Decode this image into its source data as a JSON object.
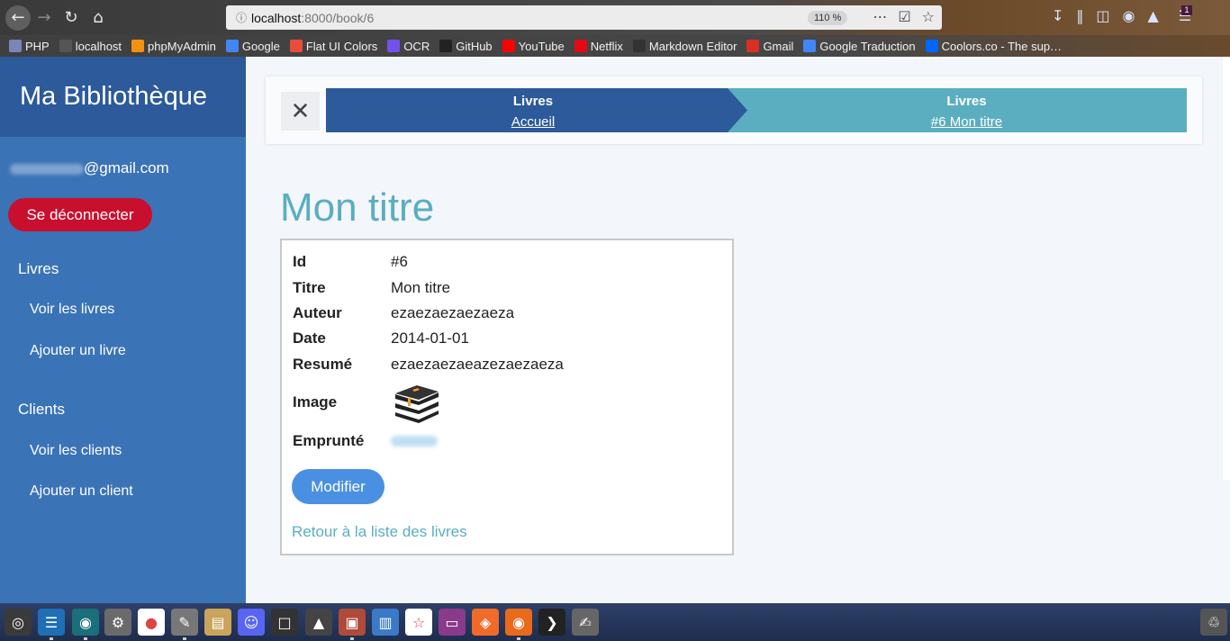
{
  "browser": {
    "url_host": "localhost",
    "url_rest": ":8000/book/6",
    "zoom": "110 %",
    "bookmarks": [
      {
        "label": "PHP",
        "icon": "php-icon",
        "color": "#7a86b8"
      },
      {
        "label": "localhost",
        "icon": "globe-icon",
        "color": "#555555"
      },
      {
        "label": "phpMyAdmin",
        "icon": "phpmyadmin-icon",
        "color": "#f29111"
      },
      {
        "label": "Google",
        "icon": "google-icon",
        "color": "#4285f4"
      },
      {
        "label": "Flat UI Colors",
        "icon": "flatui-icon",
        "color": "#e74c3c"
      },
      {
        "label": "OCR",
        "icon": "ocr-icon",
        "color": "#7451eb"
      },
      {
        "label": "GitHub",
        "icon": "github-icon",
        "color": "#222222"
      },
      {
        "label": "YouTube",
        "icon": "youtube-icon",
        "color": "#ff0000"
      },
      {
        "label": "Netflix",
        "icon": "netflix-icon",
        "color": "#e50914"
      },
      {
        "label": "Markdown Editor",
        "icon": "markdown-icon",
        "color": "#333333"
      },
      {
        "label": "Gmail",
        "icon": "gmail-icon",
        "color": "#d93025"
      },
      {
        "label": "Google Traduction",
        "icon": "translate-icon",
        "color": "#4285f4"
      },
      {
        "label": "Coolors.co - The sup…",
        "icon": "coolors-icon",
        "color": "#0066ff"
      }
    ],
    "notification_count": "1"
  },
  "sidebar": {
    "title": "Ma Bibliothèque",
    "email_visible": "@gmail.com",
    "logout_label": "Se déconnecter",
    "sections": [
      {
        "label": "Livres",
        "links": [
          "Voir les livres",
          "Ajouter un livre"
        ]
      },
      {
        "label": "Clients",
        "links": [
          "Voir les clients",
          "Ajouter un client"
        ]
      }
    ]
  },
  "breadcrumb": {
    "items": [
      {
        "title": "Livres",
        "link": "Accueil",
        "color": "#2c5a9a"
      },
      {
        "title": "Livres",
        "link": "#6 Mon titre",
        "color": "#5aaec0"
      }
    ]
  },
  "book": {
    "page_title": "Mon titre",
    "fields": [
      {
        "label": "Id",
        "value": "#6"
      },
      {
        "label": "Titre",
        "value": "Mon titre"
      },
      {
        "label": "Auteur",
        "value": "ezaezaezaezaeza"
      },
      {
        "label": "Date",
        "value": "2014-01-01"
      },
      {
        "label": "Resumé",
        "value": "ezaezaezaeazezaezaeza"
      }
    ],
    "image_label": "Image",
    "image_icon": "books-icon",
    "borrowed_label": "Emprunté",
    "edit_label": "Modifier",
    "back_label": "Retour à la liste des livres"
  },
  "taskbar": {
    "apps": [
      "ubuntu-icon",
      "vscode-icon",
      "gitkraken-icon",
      "settings-icon",
      "chrome-icon",
      "editor-icon",
      "files-icon",
      "discord-icon",
      "terminal-small-icon",
      "unity-icon",
      "archive-icon",
      "document-icon",
      "evince-icon",
      "window-icon",
      "safari-icon",
      "firefox-icon",
      "terminal-icon",
      "notes-icon",
      "trash-icon"
    ]
  }
}
